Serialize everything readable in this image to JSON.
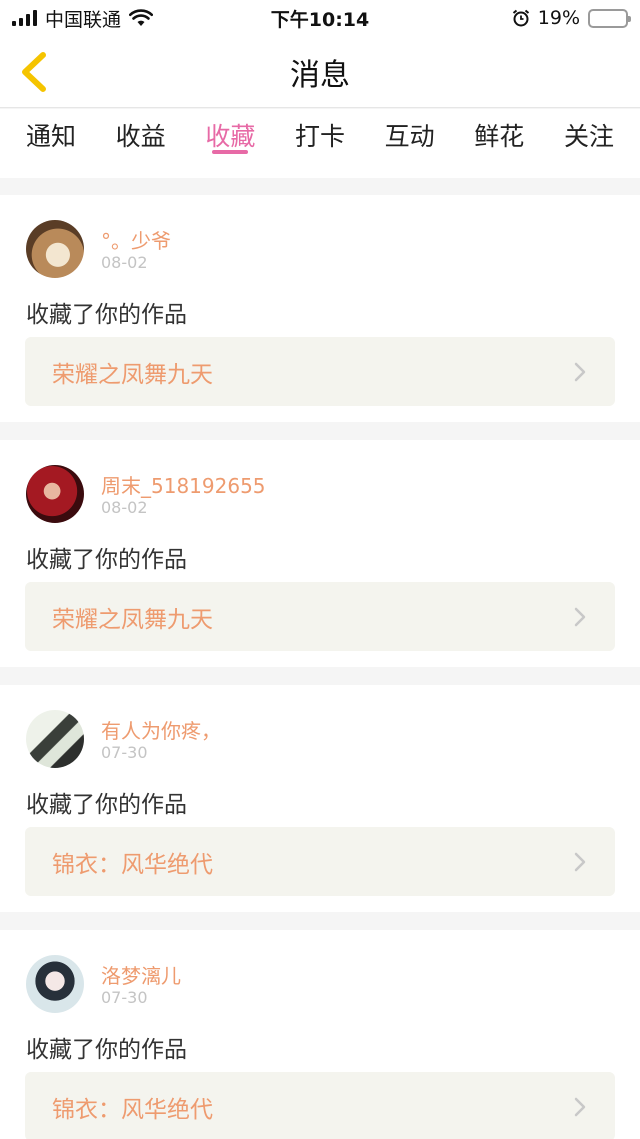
{
  "status_bar": {
    "carrier": "中国联通",
    "time": "下午10:14",
    "battery_percent": "19%",
    "battery_level": 0.19,
    "icons": [
      "signal-icon",
      "wifi-icon",
      "alarm-icon",
      "battery-icon"
    ]
  },
  "nav": {
    "title": "消息",
    "back_icon": "chevron-left-icon",
    "accent_color": "#f5c400"
  },
  "tabs": [
    {
      "label": "通知",
      "active": false
    },
    {
      "label": "收益",
      "active": false
    },
    {
      "label": "收藏",
      "active": true
    },
    {
      "label": "打卡",
      "active": false
    },
    {
      "label": "互动",
      "active": false
    },
    {
      "label": "鲜花",
      "active": false
    },
    {
      "label": "关注",
      "active": false
    }
  ],
  "colors": {
    "active_tab": "#e76aa6",
    "username": "#ee9b6f",
    "work_title": "#ee9b6f",
    "date": "#c4c4c4"
  },
  "feed": [
    {
      "username": "°。少爷",
      "date": "08-02",
      "action": "收藏了你的作品",
      "work_title": "荣耀之凤舞九天"
    },
    {
      "username": "周末_518192655",
      "date": "08-02",
      "action": "收藏了你的作品",
      "work_title": "荣耀之凤舞九天"
    },
    {
      "username": "有人为你疼，",
      "date": "07-30",
      "action": "收藏了你的作品",
      "work_title": "锦衣：风华绝代"
    },
    {
      "username": "洛梦漓儿",
      "date": "07-30",
      "action": "收藏了你的作品",
      "work_title": "锦衣：风华绝代"
    }
  ]
}
